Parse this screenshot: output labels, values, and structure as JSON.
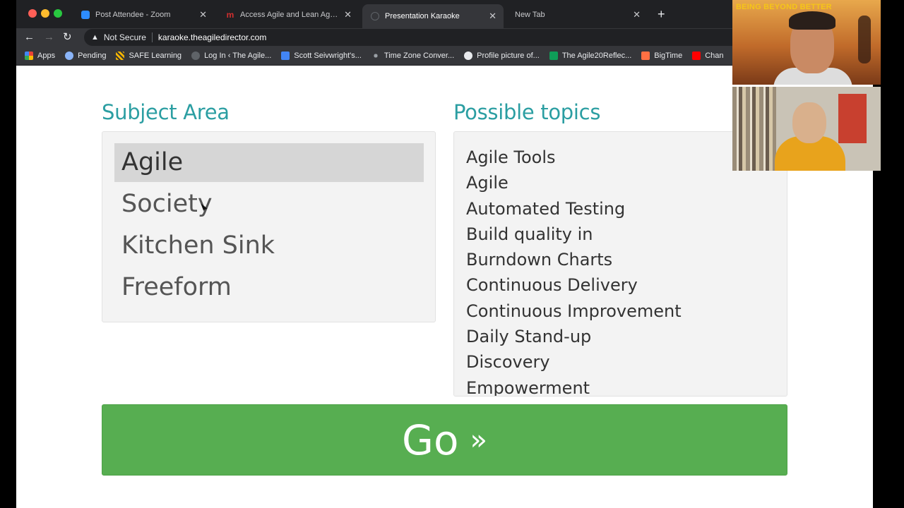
{
  "browser": {
    "tabs": [
      {
        "title": "Post Attendee - Zoom",
        "favicon_color": "#2d8cff",
        "active": false
      },
      {
        "title": "Access Agile and Lean Agile G",
        "favicon_color": "#d32f2f",
        "active": false
      },
      {
        "title": "Presentation Karaoke",
        "favicon_color": "#5f6368",
        "active": true
      },
      {
        "title": "New Tab",
        "favicon_color": "#202124",
        "active": false
      }
    ],
    "new_tab_symbol": "+",
    "security_label": "Not Secure",
    "url": "karaoke.theagiledirector.com",
    "bookmarks": [
      {
        "label": "Apps",
        "icon_color": "#ea4335"
      },
      {
        "label": "Pending",
        "icon_color": "#8ab4f8"
      },
      {
        "label": "SAFE Learning",
        "icon_color": "#f4b400"
      },
      {
        "label": "Log In ‹ The Agile...",
        "icon_color": "#5f6368"
      },
      {
        "label": "Scott Seivwright's...",
        "icon_color": "#4285f4"
      },
      {
        "label": "Time Zone Conver...",
        "icon_color": "#9aa0a6"
      },
      {
        "label": "Profile picture of...",
        "icon_color": "#e8eaed"
      },
      {
        "label": "The Agile20Reflec...",
        "icon_color": "#0f9d58"
      },
      {
        "label": "BigTime",
        "icon_color": "#ff7043"
      },
      {
        "label": "Chan",
        "icon_color": "#ff0000"
      }
    ]
  },
  "page": {
    "subject_heading": "Subject Area",
    "topics_heading": "Possible topics",
    "subjects": [
      "Agile",
      "Society",
      "Kitchen Sink",
      "Freeform"
    ],
    "selected_subject": "Agile",
    "topics": [
      "Agile Tools",
      "Agile",
      "Automated Testing",
      "Build quality in",
      "Burndown Charts",
      "Continuous Delivery",
      "Continuous Improvement",
      "Daily Stand-up",
      "Discovery",
      "Empowerment"
    ],
    "go_label": "Go",
    "go_arrow": "»"
  },
  "video": {
    "banner_text": "BEING BEYOND BETTER"
  },
  "colors": {
    "accent": "#2b9ea2",
    "go_button": "#57ae51"
  }
}
